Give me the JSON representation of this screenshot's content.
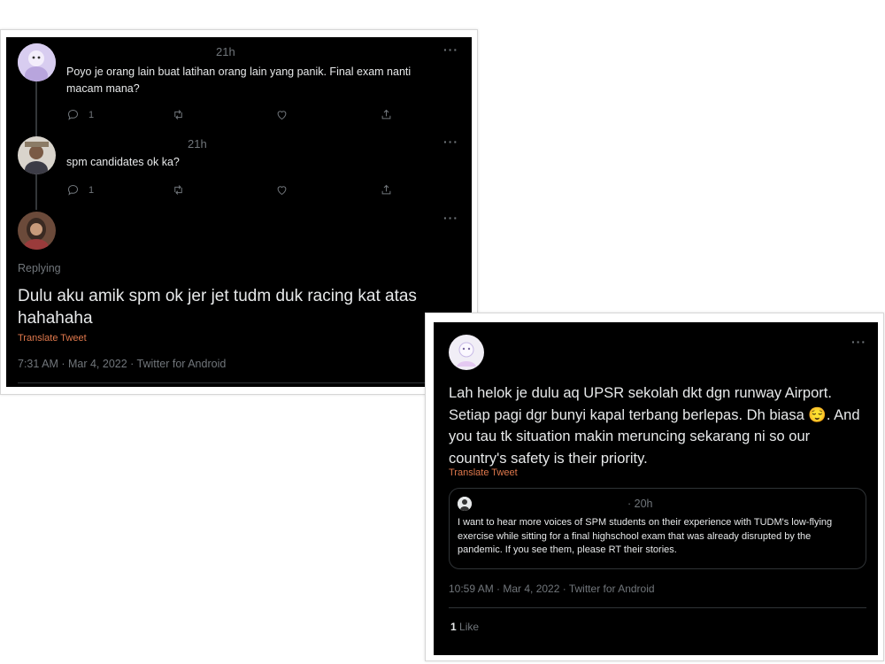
{
  "left_card": {
    "tweets": [
      {
        "time": "21h",
        "text": "Poyo je orang lain buat latihan orang lain yang panik. Final exam nanti macam mana?",
        "reply_count": "1"
      },
      {
        "time": "21h",
        "text": "spm candidates ok ka?",
        "reply_count": "1"
      }
    ],
    "main_tweet": {
      "replying_prefix": "Replying",
      "text": "Dulu aku amik spm ok jer jet tudm duk racing kat atas hahahaha",
      "translate_label": "Translate Tweet",
      "meta": "7:31 AM · Mar 4, 2022 · Twitter for Android"
    }
  },
  "right_card": {
    "text": "Lah helok je dulu aq UPSR sekolah dkt dgn runway Airport. Setiap pagi dgr bunyi kapal terbang berlepas. Dh biasa 😌. And you tau tk situation makin meruncing sekarang ni so our country's safety is their priority.",
    "translate_label": "Translate Tweet",
    "quote": {
      "time": "· 20h",
      "text": "I want to hear more voices of SPM students on their experience with TUDM's low-flying exercise while sitting for a final highschool exam that was already disrupted by the pandemic. If you see them, please RT their stories."
    },
    "meta": "10:59 AM · Mar 4, 2022 · Twitter for Android",
    "likes_count": "1",
    "likes_label": "Like"
  },
  "colors": {
    "background": "#000000",
    "text": "#e7e9ea",
    "muted": "#71767b",
    "translate": "#e0784c",
    "divider": "#2f3336"
  },
  "icons": [
    "more-icon",
    "reply-icon",
    "retweet-icon",
    "like-icon",
    "share-icon"
  ]
}
